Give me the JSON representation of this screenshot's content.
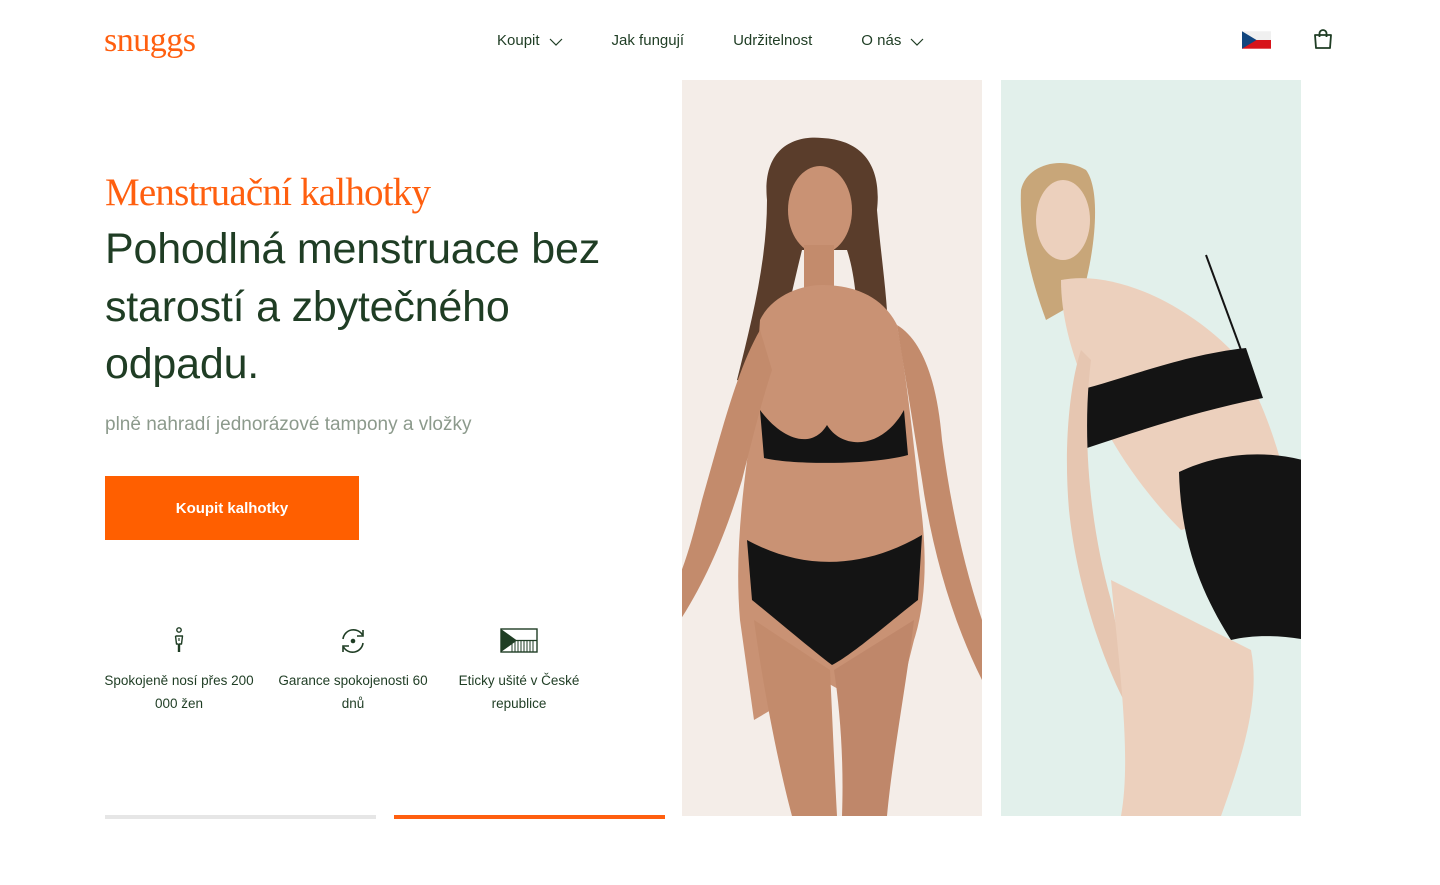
{
  "brand": {
    "logo_text": "snuggs",
    "accent": "#ff5f0f",
    "text_dark": "#1f3d24"
  },
  "nav": {
    "items": [
      {
        "label": "Koupit",
        "has_dropdown": true
      },
      {
        "label": "Jak fungují",
        "has_dropdown": false
      },
      {
        "label": "Udržitelnost",
        "has_dropdown": false
      },
      {
        "label": "O nás",
        "has_dropdown": true
      }
    ],
    "icons": [
      "czech-flag-icon",
      "shopping-bag-icon"
    ]
  },
  "hero": {
    "kicker": "Menstruační kalhotky",
    "headline": "Pohodlná menstruace bez starostí a zbytečného odpadu.",
    "subline": "plně nahradí jednorázové tampony a vložky",
    "cta_label": "Koupit kalhotky"
  },
  "features": [
    {
      "icon": "person-icon",
      "text": "Spokojeně nosí přes 200 000 žen"
    },
    {
      "icon": "refresh-guarantee-icon",
      "text": "Garance spokojenosti 60 dnů"
    },
    {
      "icon": "czech-flag-outline-icon",
      "text": "Eticky ušité v České republice"
    }
  ],
  "carousel": {
    "slides": 2,
    "active_index": 1,
    "indicators": [
      {
        "active": false
      },
      {
        "active": true
      }
    ]
  },
  "images": [
    {
      "name": "model-bikini-brief",
      "background": "#f4ede8"
    },
    {
      "name": "model-high-waist-brief",
      "background": "#e2f0eb"
    }
  ]
}
